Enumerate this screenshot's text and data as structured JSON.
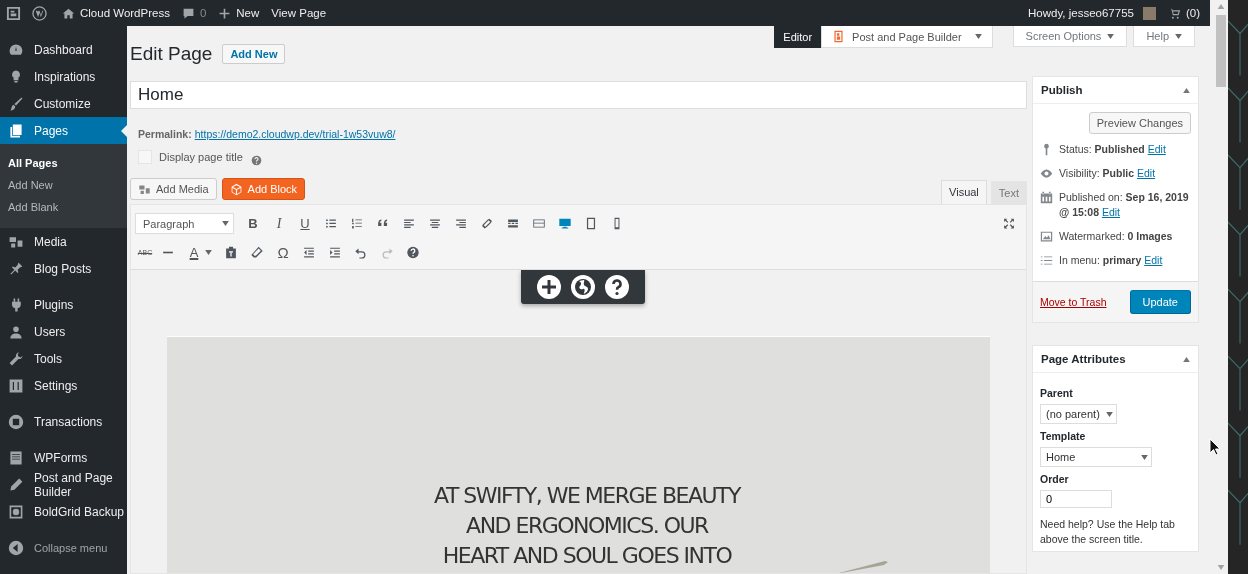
{
  "admin_bar": {
    "site": "Cloud WordPress",
    "comments": "0",
    "new": "New",
    "view": "View Page",
    "howdy": "Howdy, jesseo67755",
    "cart": "(0)"
  },
  "sidebar": {
    "groups": [
      [
        {
          "label": "Dashboard",
          "selected": false
        },
        {
          "label": "Inspirations",
          "selected": false
        },
        {
          "label": "Customize",
          "selected": false
        },
        {
          "label": "Pages",
          "selected": true,
          "children": [
            {
              "label": "All Pages",
              "selected": true
            },
            {
              "label": "Add New",
              "selected": false
            },
            {
              "label": "Add Blank",
              "selected": false
            }
          ]
        },
        {
          "label": "Media",
          "selected": false
        },
        {
          "label": "Blog Posts",
          "selected": false
        }
      ],
      [
        {
          "label": "Plugins",
          "selected": false
        },
        {
          "label": "Users",
          "selected": false
        },
        {
          "label": "Tools",
          "selected": false
        },
        {
          "label": "Settings",
          "selected": false
        }
      ],
      [
        {
          "label": "Transactions",
          "selected": false
        }
      ],
      [
        {
          "label": "WPForms",
          "selected": false
        },
        {
          "label": "Post and Page Builder",
          "selected": false
        },
        {
          "label": "BoldGrid Backup",
          "selected": false
        }
      ]
    ],
    "collapse": "Collapse menu"
  },
  "screen_tabs": [
    {
      "label": "Editor",
      "selected": true,
      "dropdown": false
    },
    {
      "label": "Post and Page Builder",
      "selected": false,
      "dropdown": true
    }
  ],
  "screen_meta": [
    "Screen Options",
    "Help"
  ],
  "heading": {
    "title": "Edit Page",
    "add_new": "Add New"
  },
  "post_title": {
    "value": "Home"
  },
  "permalink": {
    "label": "Permalink:",
    "url": "https://demo2.cloudwp.dev/trial-1w53vuw8/"
  },
  "display_title": {
    "label": "Display page title",
    "checked": false
  },
  "media_buttons": {
    "add_media": "Add Media",
    "add_block": "Add Block"
  },
  "editor_tabs": [
    {
      "label": "Visual",
      "selected": true
    },
    {
      "label": "Text",
      "selected": false
    }
  ],
  "toolbar": {
    "format": "Paragraph",
    "bold": "B",
    "italic": "I",
    "underline": "U",
    "strike": "ABC",
    "text_color": "A",
    "special_char": "Ω",
    "device_modes": [
      {
        "selected": true
      },
      {
        "selected": false
      },
      {
        "selected": false
      }
    ]
  },
  "content": {
    "headline_lines": [
      "AT SWIFTY, WE MERGE BEAUTY",
      "AND ERGONOMICS. OUR",
      "HEART AND SOUL GOES INTO"
    ]
  },
  "publish": {
    "title": "Publish",
    "preview": "Preview Changes",
    "rows": [
      {
        "label": "Status:",
        "value": "Published",
        "link": "Edit"
      },
      {
        "label": "Visibility:",
        "value": "Public",
        "link": "Edit"
      },
      {
        "label": "Published on:",
        "value": "Sep 16, 2019 @ 15:08",
        "link": "Edit"
      },
      {
        "label": "Watermarked:",
        "value": "0 Images"
      },
      {
        "label": "In menu:",
        "value": "primary",
        "link": "Edit"
      }
    ],
    "trash": "Move to Trash",
    "update": "Update"
  },
  "page_attributes": {
    "title": "Page Attributes",
    "parent_label": "Parent",
    "parent": "(no parent)",
    "template_label": "Template",
    "template": "Home",
    "order_label": "Order",
    "order": "0",
    "help": "Need help? Use the Help tab above the screen title."
  }
}
